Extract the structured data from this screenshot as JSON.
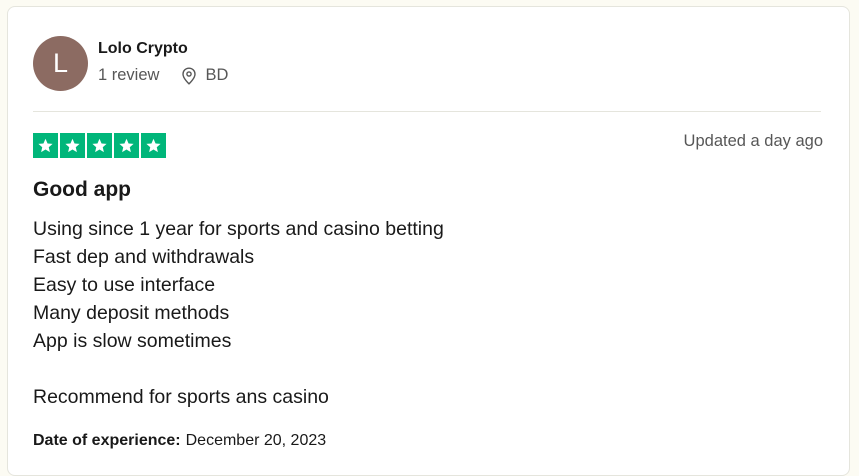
{
  "reviewer": {
    "initial": "L",
    "name": "Lolo Crypto",
    "review_count": "1 review",
    "country": "BD",
    "avatar_color": "#8c6b62"
  },
  "review": {
    "rating": 5,
    "rating_max": 5,
    "star_color": "#00b67a",
    "updated": "Updated a day ago",
    "title": "Good app",
    "body_lines": [
      "Using since 1 year for sports and casino betting",
      "Fast dep and withdrawals",
      "Easy to use interface",
      "Many deposit methods",
      "App is slow sometimes",
      "",
      "Recommend for sports ans casino"
    ],
    "experience_label": "Date of experience:",
    "experience_date": "December 20, 2023"
  }
}
